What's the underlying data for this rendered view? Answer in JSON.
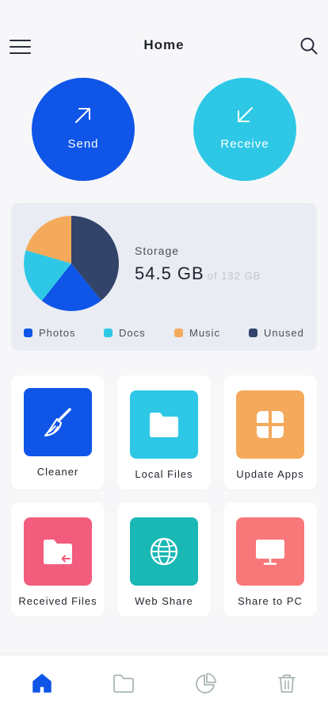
{
  "header": {
    "title": "Home",
    "menu_icon": "hamburger-menu-icon",
    "search_icon": "search-icon"
  },
  "actions": {
    "send": {
      "label": "Send",
      "icon": "arrow-up-right-icon",
      "color": "#0e55e8"
    },
    "receive": {
      "label": "Receive",
      "icon": "arrow-down-left-icon",
      "color": "#2ec8e6"
    }
  },
  "storage": {
    "label": "Storage",
    "used": "54.5 GB",
    "total": "of 132 GB",
    "legend": [
      {
        "label": "Photos",
        "color": "#0e55e8"
      },
      {
        "label": "Docs",
        "color": "#2ec8e6"
      },
      {
        "label": "Music",
        "color": "#f5a95b"
      },
      {
        "label": "Unused",
        "color": "#33446b"
      }
    ]
  },
  "tiles": [
    {
      "label": "Cleaner",
      "icon": "broom-icon",
      "color": "#0e55e8"
    },
    {
      "label": "Local Files",
      "icon": "folder-icon",
      "color": "#2ec8e6"
    },
    {
      "label": "Update Apps",
      "icon": "apps-grid-icon",
      "color": "#f5a95b"
    },
    {
      "label": "Received Files",
      "icon": "folder-download-icon",
      "color": "#f25c7d"
    },
    {
      "label": "Web Share",
      "icon": "globe-icon",
      "color": "#1ab8b4"
    },
    {
      "label": "Share to PC",
      "icon": "monitor-icon",
      "color": "#f87779"
    }
  ],
  "bottom_nav": [
    {
      "icon": "home-icon",
      "active": true
    },
    {
      "icon": "folder-icon",
      "active": false
    },
    {
      "icon": "pie-chart-icon",
      "active": false
    },
    {
      "icon": "trash-icon",
      "active": false
    }
  ],
  "colors": {
    "accent": "#0e55e8",
    "nav_inactive": "#a9b6b5"
  }
}
